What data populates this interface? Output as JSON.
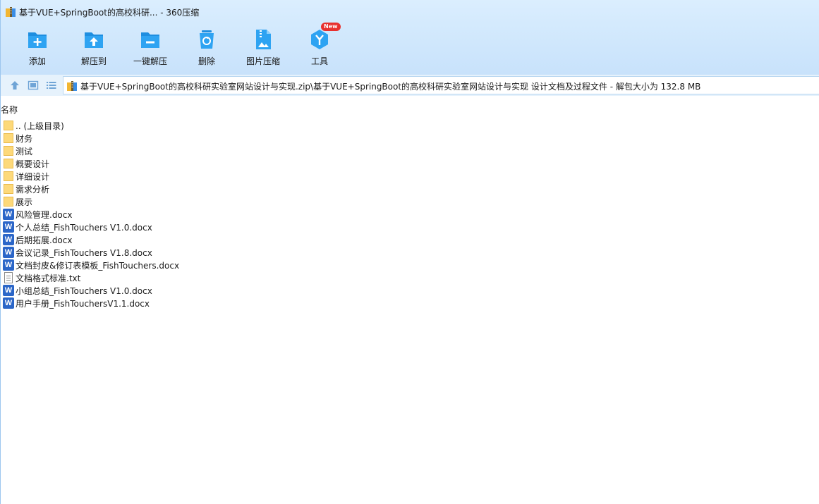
{
  "window": {
    "title": "基于VUE+SpringBoot的高校科研... - 360压缩"
  },
  "toolbar": {
    "buttons": [
      {
        "label": "添加",
        "icon": "add-icon"
      },
      {
        "label": "解压到",
        "icon": "extract-to-icon"
      },
      {
        "label": "一键解压",
        "icon": "one-click-extract-icon"
      },
      {
        "label": "删除",
        "icon": "delete-icon"
      },
      {
        "label": "图片压缩",
        "icon": "image-compress-icon"
      },
      {
        "label": "工具",
        "icon": "tools-icon",
        "badge": "New"
      }
    ]
  },
  "address": {
    "path": "基于VUE+SpringBoot的高校科研实验室网站设计与实现.zip\\基于VUE+SpringBoot的高校科研实验室网站设计与实现 设计文档及过程文件 - 解包大小为 132.8 MB"
  },
  "list": {
    "column_name": "名称",
    "items": [
      {
        "name": ".. (上级目录)",
        "type": "folder"
      },
      {
        "name": "财务",
        "type": "folder"
      },
      {
        "name": "测试",
        "type": "folder"
      },
      {
        "name": "概要设计",
        "type": "folder"
      },
      {
        "name": "详细设计",
        "type": "folder"
      },
      {
        "name": "需求分析",
        "type": "folder"
      },
      {
        "name": "展示",
        "type": "folder"
      },
      {
        "name": "风险管理.docx",
        "type": "word"
      },
      {
        "name": "个人总结_FishTouchers V1.0.docx",
        "type": "word"
      },
      {
        "name": "后期拓展.docx",
        "type": "word"
      },
      {
        "name": "会议记录_FishTouchers V1.8.docx",
        "type": "word"
      },
      {
        "name": "文档封皮&修订表模板_FishTouchers.docx",
        "type": "word"
      },
      {
        "name": "文档格式标准.txt",
        "type": "text"
      },
      {
        "name": "小组总结_FishTouchers V1.0.docx",
        "type": "word"
      },
      {
        "name": "用户手册_FishTouchersV1.1.docx",
        "type": "word"
      }
    ]
  },
  "colors": {
    "accent": "#2b9be8",
    "toolbar_bg": "#d4eafd",
    "word_icon": "#2b66c8",
    "folder": "#fdd97a",
    "badge": "#e8302e"
  }
}
